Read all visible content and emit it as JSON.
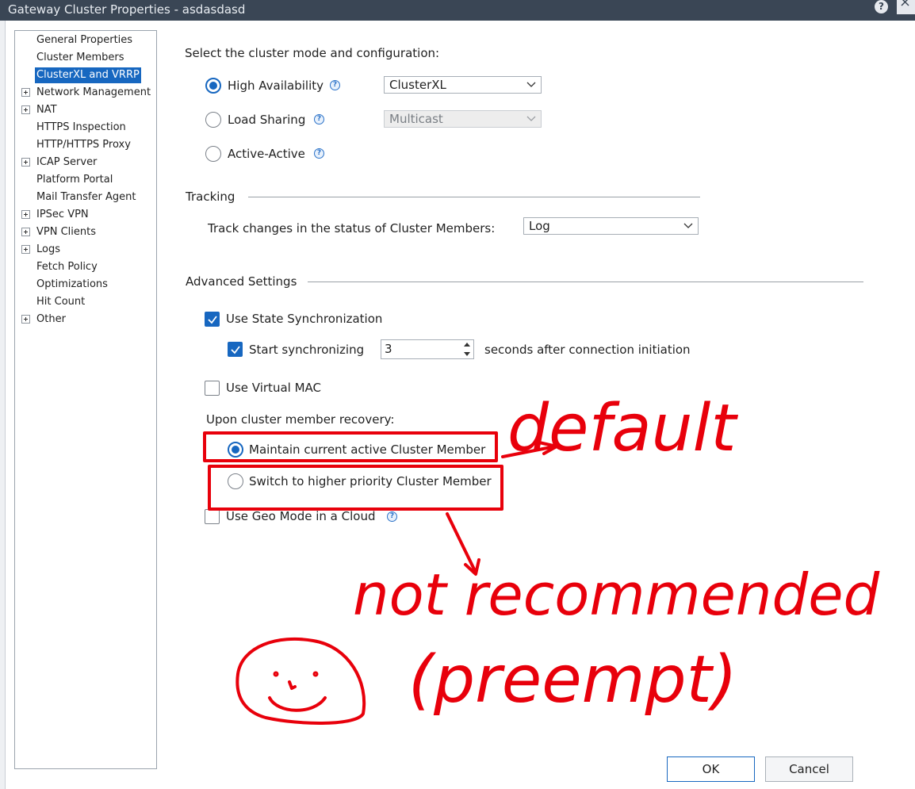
{
  "window": {
    "title": "Gateway Cluster Properties - asdasdasd",
    "help_glyph": "?"
  },
  "nav": {
    "items": [
      {
        "label": "General Properties",
        "expandable": false,
        "selected": false
      },
      {
        "label": "Cluster Members",
        "expandable": false,
        "selected": false
      },
      {
        "label": "ClusterXL and VRRP",
        "expandable": false,
        "selected": true
      },
      {
        "label": "Network Management",
        "expandable": true,
        "selected": false
      },
      {
        "label": "NAT",
        "expandable": true,
        "selected": false
      },
      {
        "label": "HTTPS Inspection",
        "expandable": false,
        "selected": false
      },
      {
        "label": "HTTP/HTTPS Proxy",
        "expandable": false,
        "selected": false
      },
      {
        "label": "ICAP Server",
        "expandable": true,
        "selected": false
      },
      {
        "label": "Platform Portal",
        "expandable": false,
        "selected": false
      },
      {
        "label": "Mail Transfer Agent",
        "expandable": false,
        "selected": false
      },
      {
        "label": "IPSec VPN",
        "expandable": true,
        "selected": false
      },
      {
        "label": "VPN Clients",
        "expandable": true,
        "selected": false
      },
      {
        "label": "Logs",
        "expandable": true,
        "selected": false
      },
      {
        "label": "Fetch Policy",
        "expandable": false,
        "selected": false
      },
      {
        "label": "Optimizations",
        "expandable": false,
        "selected": false
      },
      {
        "label": "Hit Count",
        "expandable": false,
        "selected": false
      },
      {
        "label": "Other",
        "expandable": true,
        "selected": false
      }
    ]
  },
  "mode": {
    "heading": "Select the cluster mode and configuration:",
    "high_availability": {
      "label": "High Availability",
      "selected": true,
      "combo_value": "ClusterXL"
    },
    "load_sharing": {
      "label": "Load Sharing",
      "selected": false,
      "combo_value": "Multicast"
    },
    "active_active": {
      "label": "Active-Active",
      "selected": false
    },
    "help_glyph": "?"
  },
  "tracking": {
    "heading": "Tracking",
    "label": "Track changes in the status of Cluster Members:",
    "value": "Log"
  },
  "advanced": {
    "heading": "Advanced Settings",
    "use_state_sync": {
      "label": "Use State Synchronization",
      "checked": true
    },
    "start_sync": {
      "label": "Start synchronizing",
      "checked": true,
      "value": "3",
      "suffix": "seconds after connection initiation"
    },
    "use_virtual_mac": {
      "label": "Use Virtual MAC",
      "checked": false
    },
    "recovery_heading": "Upon cluster member recovery:",
    "maintain_active": {
      "label": "Maintain current active Cluster Member",
      "selected": true
    },
    "switch_priority": {
      "label": "Switch to higher priority Cluster Member",
      "selected": false
    },
    "geo_mode": {
      "label": "Use Geo Mode in a Cloud",
      "checked": false
    }
  },
  "buttons": {
    "ok": "OK",
    "cancel": "Cancel"
  },
  "annotations": {
    "color": "#e8000b",
    "text_default": "default",
    "text_not_recommended": "not recommended",
    "text_preempt": "(preempt)"
  },
  "colors": {
    "accent": "#1767c0",
    "titlebar": "#3a4655"
  }
}
